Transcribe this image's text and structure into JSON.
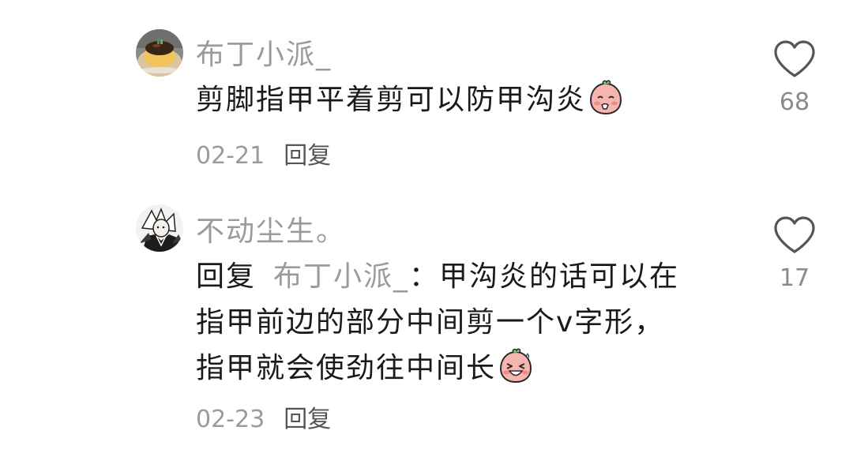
{
  "comments": [
    {
      "username": "布丁小派_",
      "text": "剪脚指甲平着剪可以防甲沟炎",
      "date": "02-21",
      "reply_label": "回复",
      "like_count": "68",
      "avatar_icon": "pudding-avatar",
      "emoji_icon": "shy-peach-emoji"
    },
    {
      "username": "不动尘生。",
      "reply_prefix": "回复",
      "reply_to": "布丁小派_",
      "reply_colon": "：",
      "text_lines": [
        "甲沟炎的话可以在",
        "指甲前边的部分中间剪一个v字形，",
        "指甲就会使劲往中间长"
      ],
      "date": "02-23",
      "reply_label": "回复",
      "like_count": "17",
      "avatar_icon": "anime-character-avatar",
      "emoji_icon": "laughing-peach-emoji"
    }
  ],
  "colors": {
    "username": "#9b9b9b",
    "body_text": "#1a1a1a",
    "meta": "#9b9b9b",
    "heart_outline": "#555555",
    "emoji_peach": "#f7b5b0"
  }
}
